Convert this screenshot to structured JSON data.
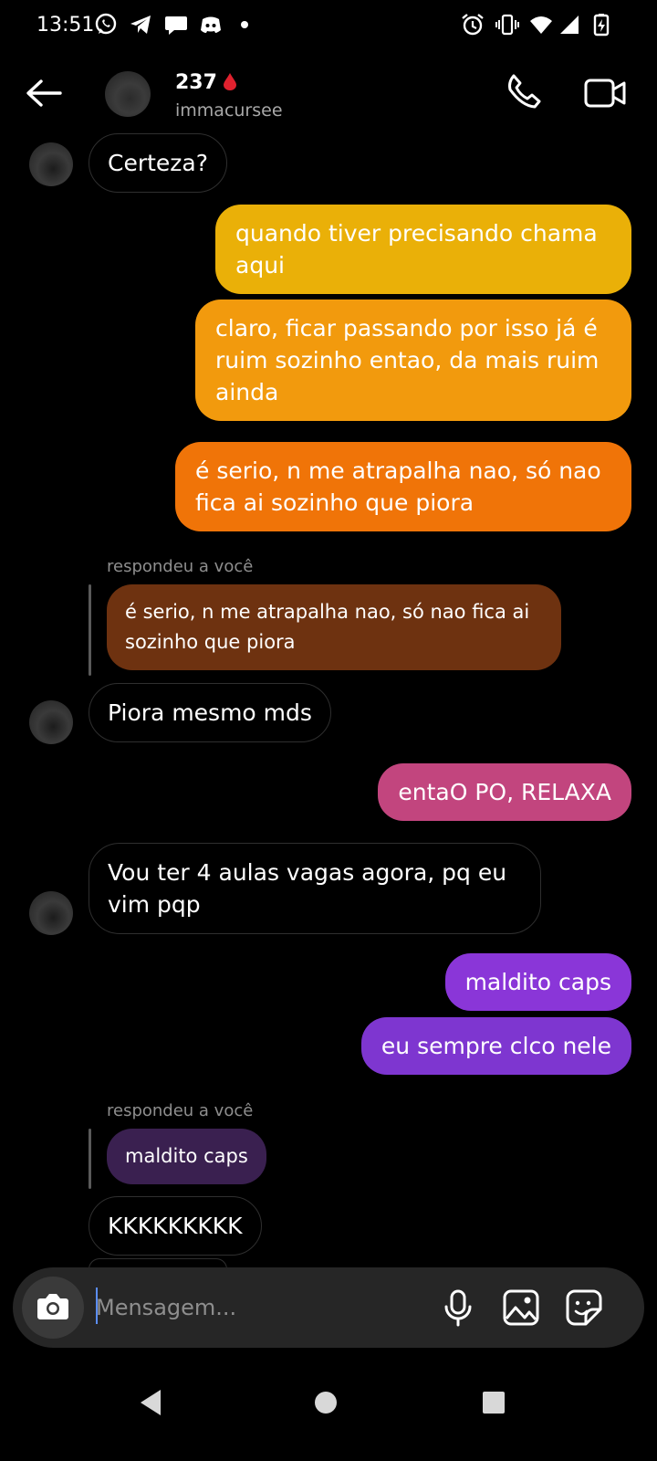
{
  "status": {
    "time": "13:51"
  },
  "header": {
    "name": "237",
    "username": "immacursee"
  },
  "messages": [
    {
      "side": "in",
      "text": "Certeza?"
    },
    {
      "side": "out",
      "text": "quando tiver precisando chama aqui",
      "color": "#eab008"
    },
    {
      "side": "out",
      "text": "claro, ficar passando por isso já é ruim sozinho entao, da mais ruim ainda",
      "color": "#f29a0d"
    },
    {
      "side": "out",
      "text": "é serio, n me atrapalha nao, só nao fica ai sozinho que piora",
      "color": "#f07408"
    },
    {
      "side": "in",
      "reply_label": "respondeu a você",
      "quoted": "é serio, n me atrapalha nao, só nao fica ai sozinho que piora",
      "quoted_color": "#6e3210"
    },
    {
      "side": "in",
      "text": "Piora mesmo mds"
    },
    {
      "side": "out",
      "text": "entaO PO, RELAXA",
      "color": "#c2457e"
    },
    {
      "side": "in",
      "text": "Vou ter 4 aulas vagas agora, pq eu vim pqp"
    },
    {
      "side": "out",
      "text": "maldito caps",
      "color": "#8a36d8"
    },
    {
      "side": "out",
      "text": "eu sempre clco nele",
      "color": "#7e36d0"
    },
    {
      "side": "in",
      "reply_label": "respondeu a você",
      "quoted": "maldito caps",
      "quoted_color": "#3a2050"
    },
    {
      "side": "in",
      "text": "KKKKKKKKK"
    }
  ],
  "composer": {
    "placeholder": "Mensagem..."
  },
  "icons": {
    "status": [
      "whatsapp-icon",
      "telegram-icon",
      "messages-icon",
      "discord-icon",
      "notification-dot-icon",
      "alarm-icon",
      "vibrate-icon",
      "wifi-icon",
      "signal-icon",
      "battery-icon"
    ],
    "header": [
      "back-arrow-icon",
      "phone-icon",
      "video-camera-icon"
    ],
    "composer": [
      "camera-icon",
      "microphone-icon",
      "gallery-icon",
      "sticker-icon"
    ],
    "nav": [
      "back-triangle-icon",
      "home-circle-icon",
      "recents-square-icon"
    ]
  }
}
